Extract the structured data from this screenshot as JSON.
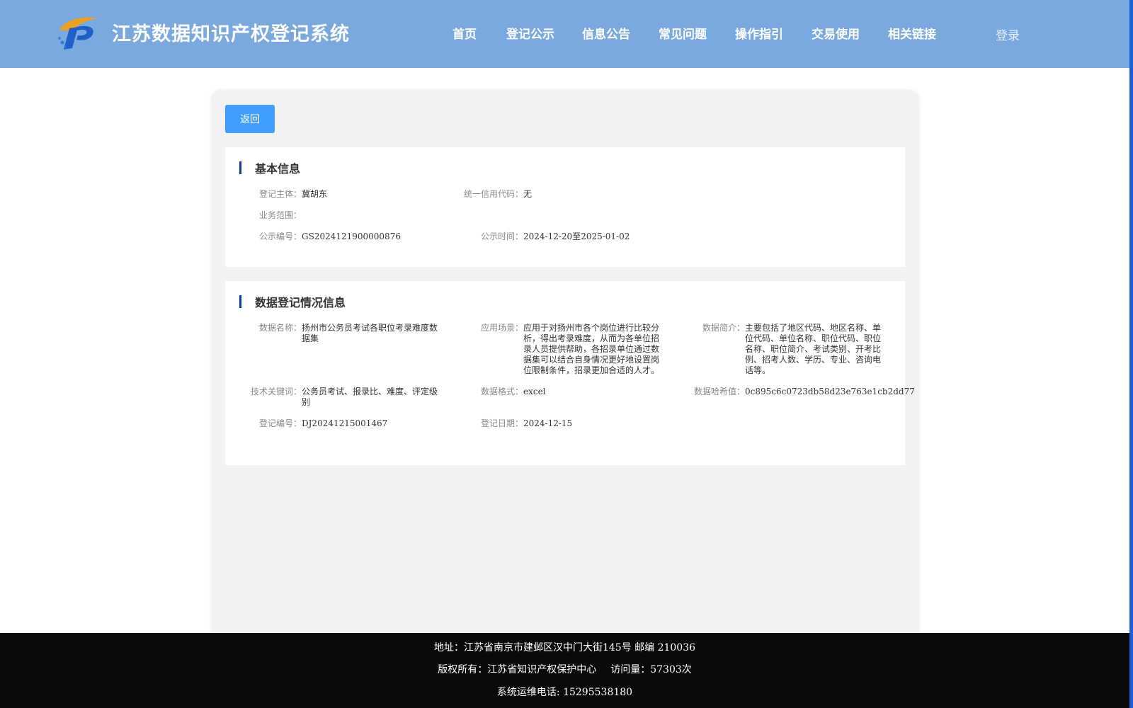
{
  "header": {
    "site_title": "江苏数据知识产权登记系统",
    "nav": [
      "首页",
      "登记公示",
      "信息公告",
      "常见问题",
      "操作指引",
      "交易使用",
      "相关链接"
    ],
    "login_label": "登录",
    "colors": {
      "header_bg": "#79a9de",
      "accent": "#409eff",
      "section_bar": "#0d3f8f"
    }
  },
  "back_label": "返回",
  "basic": {
    "title": "基本信息",
    "fields": [
      {
        "label": "登记主体：",
        "value": "冀胡东"
      },
      {
        "label": "统一信用代码：",
        "value": "无"
      },
      {
        "label": "业务范围：",
        "value": ""
      },
      {
        "label": "公示编号：",
        "value": "GS2024121900000876"
      },
      {
        "label": "公示时间：",
        "value": "2024-12-20至2025-01-02"
      }
    ]
  },
  "registration": {
    "title": "数据登记情况信息",
    "fields": [
      {
        "label": "数据名称：",
        "value": "扬州市公务员考试各职位考录难度数据集"
      },
      {
        "label": "应用场景：",
        "value": "应用于对扬州市各个岗位进行比较分析，得出考录难度，从而为各单位招录人员提供帮助，各招录单位通过数据集可以结合自身情况更好地设置岗位限制条件，招录更加合适的人才。"
      },
      {
        "label": "数据简介：",
        "value": "主要包括了地区代码、地区名称、单位代码、单位名称、职位代码、职位名称、职位简介、考试类别、开考比例、招考人数、学历、专业、咨询电话等。"
      },
      {
        "label": "技术关键词：",
        "value": "公务员考试、报录比、难度、评定级别"
      },
      {
        "label": "数据格式：",
        "value": "excel"
      },
      {
        "label": "数据哈希值：",
        "value": "0c895c6c0723db58d23e763e1cb2dd77"
      },
      {
        "label": "登记编号：",
        "value": "DJ20241215001467"
      },
      {
        "label": "登记日期：",
        "value": "2024-12-15"
      }
    ]
  },
  "footer": {
    "address": "地址：江苏省南京市建邺区汉中门大街145号 邮编 210036",
    "copyright": "版权所有：江苏省知识产权保护中心",
    "visits": "访问量：57303次",
    "phone": "系统运维电话: 15295538180"
  }
}
